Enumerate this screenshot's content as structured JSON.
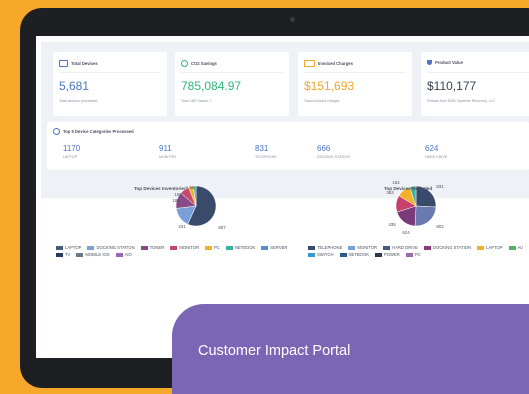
{
  "cards": [
    {
      "title": "Total Devices",
      "value": "5,681",
      "sub": "Total devices processed",
      "color": "#4b74c2",
      "icon": "device-icon"
    },
    {
      "title": "CO2 Savings",
      "value": "785,084.97",
      "sub": "Total LBS Saved ⓘ",
      "color": "#2eb87a",
      "icon": "leaf-icon"
    },
    {
      "title": "Invoiced Charges",
      "value": "$151,693",
      "sub": "Total invoiced charges",
      "color": "#f3a72a",
      "icon": "folder-icon"
    },
    {
      "title": "Product Value",
      "value": "$110,177",
      "sub": "Rebate from DMD Systems Recovery, LLC",
      "color": "#3a4050",
      "icon": "trophy-icon"
    }
  ],
  "categories": {
    "title": "Top 5 Device Categories Processed",
    "items": [
      {
        "value": "1170",
        "label": "LAPTOP"
      },
      {
        "value": "911",
        "label": "MONITOR"
      },
      {
        "value": "831",
        "label": "TELEPHONE"
      },
      {
        "value": "666",
        "label": "DOCKING STATION"
      },
      {
        "value": "624",
        "label": "HARD DRIVE"
      }
    ]
  },
  "chart_data": [
    {
      "type": "pie",
      "title": "Top Devices Inventoried/Sold",
      "slices": [
        {
          "label": "SERVER",
          "value": 807,
          "color": "#3a4a6b"
        },
        {
          "label": "DOCKING STATION",
          "value": 231,
          "color": "#7b9fd8"
        },
        {
          "label": "TONER",
          "value": 188,
          "color": "#8a4a8a"
        },
        {
          "label": "MONITOR",
          "value": 109,
          "color": "#c94a6a"
        },
        {
          "label": "PC",
          "value": 56,
          "color": "#f3b22a"
        },
        {
          "label": "NETBOOK",
          "value": 30,
          "color": "#3ab0a0"
        }
      ],
      "labels_shown": [
        "56",
        "109",
        "188",
        "231",
        "807"
      ],
      "legend": [
        "LAPTOP",
        "DOCKING STATION",
        "TONER",
        "MONITOR",
        "PC",
        "NETBOOK",
        "SERVER",
        "TV",
        "MOBILE IOS",
        "AIO"
      ],
      "legend_colors": [
        "#4a5a7a",
        "#7b9fd8",
        "#8a4a8a",
        "#c94a6a",
        "#f3b22a",
        "#3ab0a0",
        "#5a8ad0",
        "#2a3a5a",
        "#6a7a8a",
        "#9a6ab0"
      ]
    },
    {
      "type": "pie",
      "title": "Top Devices Recycled",
      "slices": [
        {
          "label": "TELEPHONE",
          "value": 831,
          "color": "#3a4a6b"
        },
        {
          "label": "HARD DRIVE",
          "value": 802,
          "color": "#6a7ab0"
        },
        {
          "label": "DOCKING STATION",
          "value": 624,
          "color": "#7b3a7a"
        },
        {
          "label": "MONITOR",
          "value": 435,
          "color": "#c9406a"
        },
        {
          "label": "AV",
          "value": 363,
          "color": "#f3b22a"
        },
        {
          "label": "SWITCH",
          "value": 164,
          "color": "#3ab0a0"
        }
      ],
      "labels_shown": [
        "164",
        "831",
        "363",
        "802",
        "435",
        "624"
      ],
      "legend": [
        "TELEPHONE",
        "MONITOR",
        "HARD DRIVE",
        "DOCKING STATION",
        "LAPTOP",
        "AV",
        "SWITCH",
        "NETBOOK",
        "POWER",
        "PC"
      ],
      "legend_colors": [
        "#3a4a6b",
        "#7b9fd8",
        "#4a5a7a",
        "#8a3a7a",
        "#f3b22a",
        "#5ab06a",
        "#3a9ad0",
        "#2a5a8a",
        "#2a3a4a",
        "#9a6ab0"
      ]
    }
  ],
  "banner": {
    "text": "Customer Impact Portal"
  }
}
